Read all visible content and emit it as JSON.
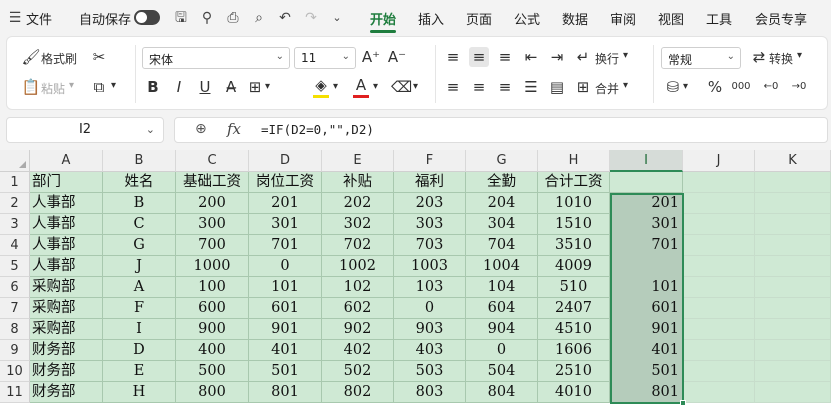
{
  "menu": {
    "file_icon": "menu-lines-icon",
    "file_label": "文件",
    "autosave_label": "自动保存",
    "tabs": [
      "开始",
      "插入",
      "页面",
      "公式",
      "数据",
      "审阅",
      "视图",
      "工具",
      "会员专享"
    ],
    "active_tab": "开始"
  },
  "ribbon": {
    "format_painter": "格式刷",
    "paste": "粘贴",
    "font_name": "宋体",
    "font_size": "11",
    "wrap": "换行",
    "merge": "合并",
    "number_format": "常规",
    "convert": "转换",
    "bold": "B",
    "italic": "I",
    "underline": "U",
    "font_color": "A",
    "highlight_color": "#f5e000",
    "text_color": "#e02020",
    "percent": "%"
  },
  "formula_bar": {
    "name_box": "I2",
    "fx_label": "fx",
    "formula": "=IF(D2=0,\"\",D2)"
  },
  "grid": {
    "columns": [
      "A",
      "B",
      "C",
      "D",
      "E",
      "F",
      "G",
      "H",
      "I",
      "J",
      "K"
    ],
    "selected_column": "I",
    "rows": [
      "1",
      "2",
      "3",
      "4",
      "5",
      "6",
      "7",
      "8",
      "9",
      "10",
      "11"
    ],
    "header_row": [
      "部门",
      "姓名",
      "基础工资",
      "岗位工资",
      "补贴",
      "福利",
      "全勤",
      "合计工资",
      ""
    ],
    "data": [
      [
        "人事部",
        "B",
        "200",
        "201",
        "202",
        "203",
        "204",
        "1010",
        "201"
      ],
      [
        "人事部",
        "C",
        "300",
        "301",
        "302",
        "303",
        "304",
        "1510",
        "301"
      ],
      [
        "人事部",
        "G",
        "700",
        "701",
        "702",
        "703",
        "704",
        "3510",
        "701"
      ],
      [
        "人事部",
        "J",
        "1000",
        "0",
        "1002",
        "1003",
        "1004",
        "4009",
        ""
      ],
      [
        "采购部",
        "A",
        "100",
        "101",
        "102",
        "103",
        "104",
        "510",
        "101"
      ],
      [
        "采购部",
        "F",
        "600",
        "601",
        "602",
        "0",
        "604",
        "2407",
        "601"
      ],
      [
        "采购部",
        "I",
        "900",
        "901",
        "902",
        "903",
        "904",
        "4510",
        "901"
      ],
      [
        "财务部",
        "D",
        "400",
        "401",
        "402",
        "403",
        "0",
        "1606",
        "401"
      ],
      [
        "财务部",
        "E",
        "500",
        "501",
        "502",
        "503",
        "504",
        "2510",
        "501"
      ],
      [
        "财务部",
        "H",
        "800",
        "801",
        "802",
        "803",
        "804",
        "4010",
        "801"
      ]
    ]
  }
}
